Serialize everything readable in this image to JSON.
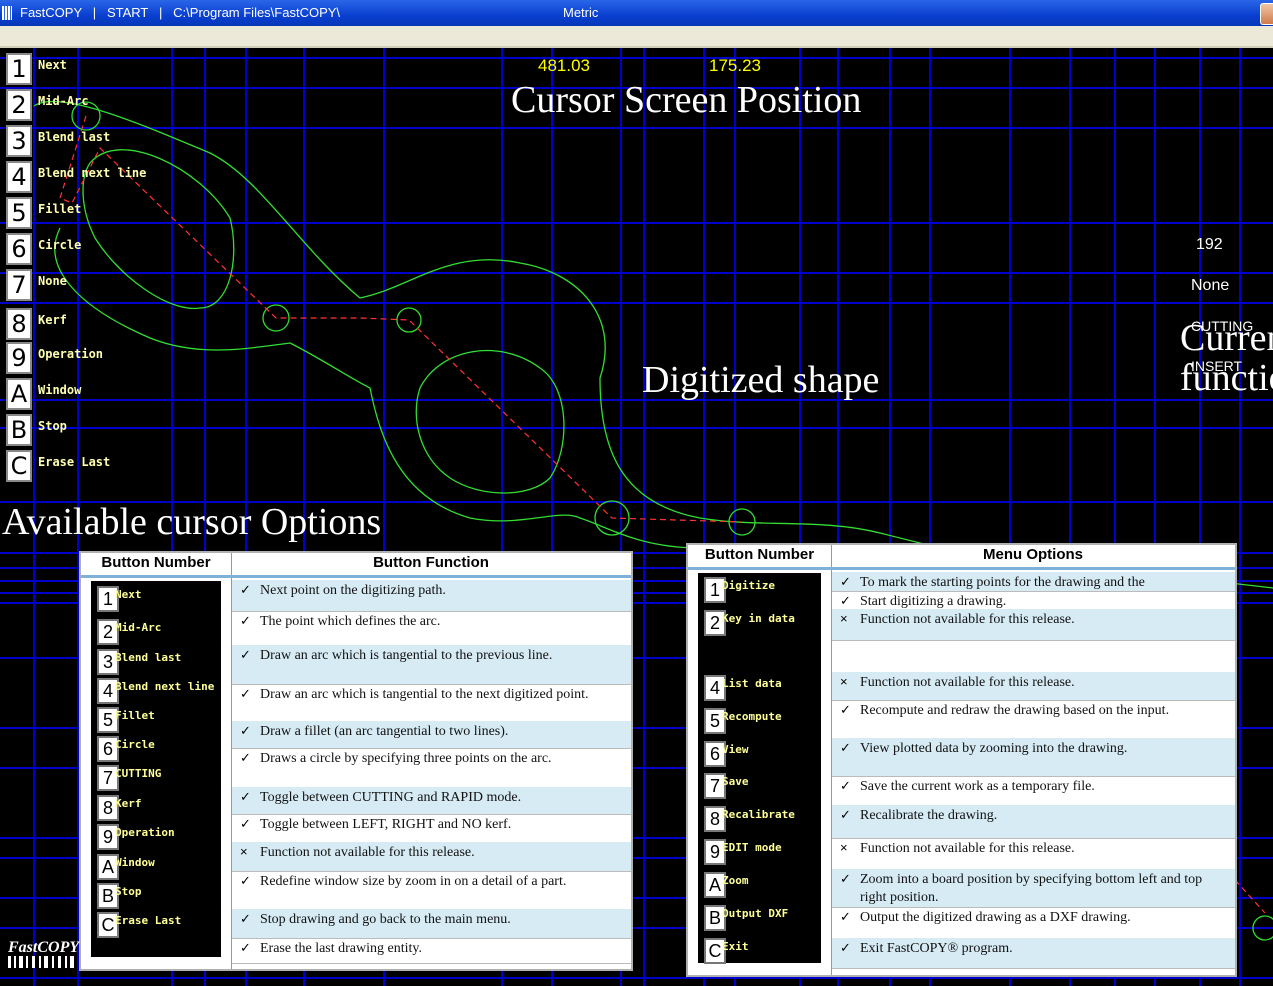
{
  "title_bar": {
    "text": "FastCOPY   |   START   |   C:\\Program Files\\FastCOPY\\",
    "units": "Metric"
  },
  "cursor_position": {
    "x": "481.03",
    "y": "175.23",
    "caption": "Cursor Screen Position"
  },
  "shape_caption": "Digitized shape",
  "options_caption": "Available cursor Options",
  "status": {
    "count": "192",
    "kerf": "None",
    "mode": "CUTTING",
    "edit": "INSERT",
    "caption_line1": "Current",
    "caption_line2": "function"
  },
  "cursor_options": [
    {
      "key": "1",
      "label": "Next"
    },
    {
      "key": "2",
      "label": "Mid-Arc"
    },
    {
      "key": "3",
      "label": "Blend last"
    },
    {
      "key": "4",
      "label": "Blend next line"
    },
    {
      "key": "5",
      "label": "Fillet"
    },
    {
      "key": "6",
      "label": "Circle"
    },
    {
      "key": "7",
      "label": "None"
    },
    {
      "key": "8",
      "label": "Kerf"
    },
    {
      "key": "9",
      "label": "Operation"
    },
    {
      "key": "A",
      "label": "Window"
    },
    {
      "key": "B",
      "label": "Stop"
    },
    {
      "key": "C",
      "label": "Erase Last"
    }
  ],
  "button_table": {
    "headers": [
      "Button Number",
      "Button Function"
    ],
    "buttons": [
      {
        "key": "1",
        "label": "Next"
      },
      {
        "key": "2",
        "label": "Mid-Arc"
      },
      {
        "key": "3",
        "label": "Blend last"
      },
      {
        "key": "4",
        "label": "Blend next line"
      },
      {
        "key": "5",
        "label": "Fillet"
      },
      {
        "key": "6",
        "label": "Circle"
      },
      {
        "key": "7",
        "label": "CUTTING"
      },
      {
        "key": "8",
        "label": "Kerf"
      },
      {
        "key": "9",
        "label": "Operation"
      },
      {
        "key": "A",
        "label": "Window"
      },
      {
        "key": "B",
        "label": "Stop"
      },
      {
        "key": "C",
        "label": "Erase Last"
      }
    ],
    "rows": [
      {
        "mark": "check",
        "text": "Next point on the digitizing path."
      },
      {
        "mark": "check",
        "text": "The point which defines the arc."
      },
      {
        "mark": "check",
        "text": "Draw an arc which is tangential to the previous line."
      },
      {
        "mark": "check",
        "text": "Draw an arc which is tangential to the next digitized point."
      },
      {
        "mark": "check",
        "text": "Draw a fillet (an arc tangential to two lines)."
      },
      {
        "mark": "check",
        "text": "Draws a circle by specifying three points on the arc."
      },
      {
        "mark": "check",
        "text": "Toggle between CUTTING and RAPID mode."
      },
      {
        "mark": "check",
        "text": "Toggle between LEFT, RIGHT and NO kerf."
      },
      {
        "mark": "cross",
        "text": "Function not available  for this release."
      },
      {
        "mark": "check",
        "text": "Redefine window size by zoom in on a detail of a part."
      },
      {
        "mark": "check",
        "text": "Stop drawing and go back to the main menu."
      },
      {
        "mark": "check",
        "text": "Erase the last drawing entity."
      }
    ]
  },
  "menu_table": {
    "headers": [
      "Button Number",
      "Menu Options"
    ],
    "buttons": [
      {
        "key": "1",
        "label": "Digitize"
      },
      {
        "key": "2",
        "label": "Key in data"
      },
      {
        "key": "4",
        "label": "List data"
      },
      {
        "key": "5",
        "label": "Recompute"
      },
      {
        "key": "6",
        "label": "View"
      },
      {
        "key": "7",
        "label": "Save"
      },
      {
        "key": "8",
        "label": "Recalibrate"
      },
      {
        "key": "9",
        "label": "EDIT mode"
      },
      {
        "key": "A",
        "label": "Zoom"
      },
      {
        "key": "B",
        "label": "Output DXF"
      },
      {
        "key": "C",
        "label": "Exit"
      }
    ],
    "rows": [
      {
        "mark": "check",
        "text": "To mark the starting points for the drawing and the"
      },
      {
        "mark": "check",
        "text": "Start digitizing a drawing."
      },
      {
        "mark": "cross",
        "text": "Function not available  for this release."
      },
      {
        "mark": "",
        "text": ""
      },
      {
        "mark": "cross",
        "text": "Function not available  for this release."
      },
      {
        "mark": "check",
        "text": "Recompute and redraw the drawing based on the input."
      },
      {
        "mark": "check",
        "text": "View plotted data by zooming into the drawing."
      },
      {
        "mark": "check",
        "text": "Save the current work as a temporary file."
      },
      {
        "mark": "check",
        "text": "Recalibrate the drawing."
      },
      {
        "mark": "cross",
        "text": "Function not available  for this release."
      },
      {
        "mark": "check",
        "text": "Zoom into a board position by specifying bottom left and top right position."
      },
      {
        "mark": "check",
        "text": "Output the digitized drawing as a DXF drawing."
      },
      {
        "mark": "check",
        "text": "Exit FastCOPY® program."
      }
    ]
  },
  "logo_text": "FastCOPY",
  "colors": {
    "grid": "#0000cc",
    "shape": "#33dd33",
    "path": "#ff3333",
    "label": "#ffff99",
    "coord": "#ffff00"
  }
}
